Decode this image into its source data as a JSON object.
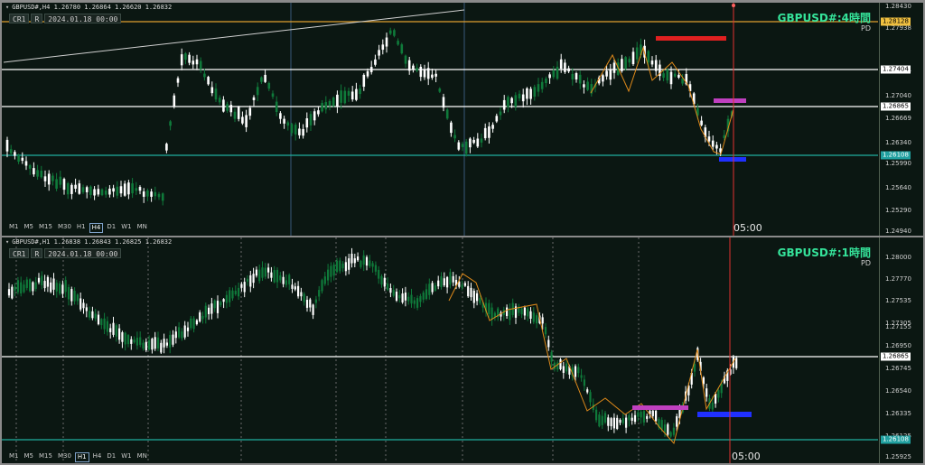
{
  "top": {
    "header": "GBPUSD#,H4  1.26780 1.26864 1.26620 1.26832",
    "cr": "CR1",
    "r": "R",
    "datetime": "2024.01.18 00:00",
    "title": "GBPUSD#:4時間",
    "subtitle": "PD",
    "time_label": "05:00",
    "timeframes": [
      "M1",
      "M5",
      "M15",
      "M30",
      "H1",
      "H4",
      "D1",
      "W1",
      "MN"
    ],
    "active_tf": "H4",
    "axis": {
      "ticks": [
        "1.28430",
        "1.27938",
        "1.27404",
        "1.27040",
        "1.26669",
        "1.26340",
        "1.25990",
        "1.25640",
        "1.25290",
        "1.24940"
      ],
      "price_labels": [
        {
          "text": "1.28128",
          "bg": "#f0c040",
          "fg": "#000000"
        },
        {
          "text": "1.27404",
          "bg": "#ffffff",
          "fg": "#000000"
        },
        {
          "text": "1.26865",
          "bg": "#ffffff",
          "fg": "#000000"
        },
        {
          "text": "1.26108",
          "bg": "#20a0a0",
          "fg": "#ffffff"
        }
      ]
    }
  },
  "bottom": {
    "header": "GBPUSD#,H1  1.26838 1.26843 1.26825 1.26832",
    "cr": "CR1",
    "r": "R",
    "datetime": "2024.01.18 00:00",
    "title": "GBPUSD#:1時間",
    "subtitle": "PD",
    "time_label": "05:00",
    "timeframes": [
      "M1",
      "M5",
      "M15",
      "M30",
      "H1",
      "H4",
      "D1",
      "W1",
      "MN"
    ],
    "active_tf": "H1",
    "axis": {
      "ticks": [
        "1.28000",
        "1.27770",
        "1.27535",
        "1.27305",
        "1.27155",
        "1.26950",
        "1.26745",
        "1.26540",
        "1.26335",
        "1.26125",
        "1.25925"
      ],
      "price_labels": [
        {
          "text": "1.26865",
          "bg": "#ffffff",
          "fg": "#000000"
        },
        {
          "text": "1.26108",
          "bg": "#20a0a0",
          "fg": "#ffffff"
        }
      ]
    }
  },
  "colors": {
    "background": "#0b1712",
    "bull": "#ffffff",
    "bear": "#0f7a3a",
    "accent_green": "#35e39a",
    "orange_level": "#e0a030",
    "white_level": "#ffffff",
    "cyan_level": "#20b0a0",
    "red_marker": "#e02020",
    "magenta_marker": "#c040c0",
    "blue_marker": "#2030ff",
    "time_line": "#e03030"
  }
}
